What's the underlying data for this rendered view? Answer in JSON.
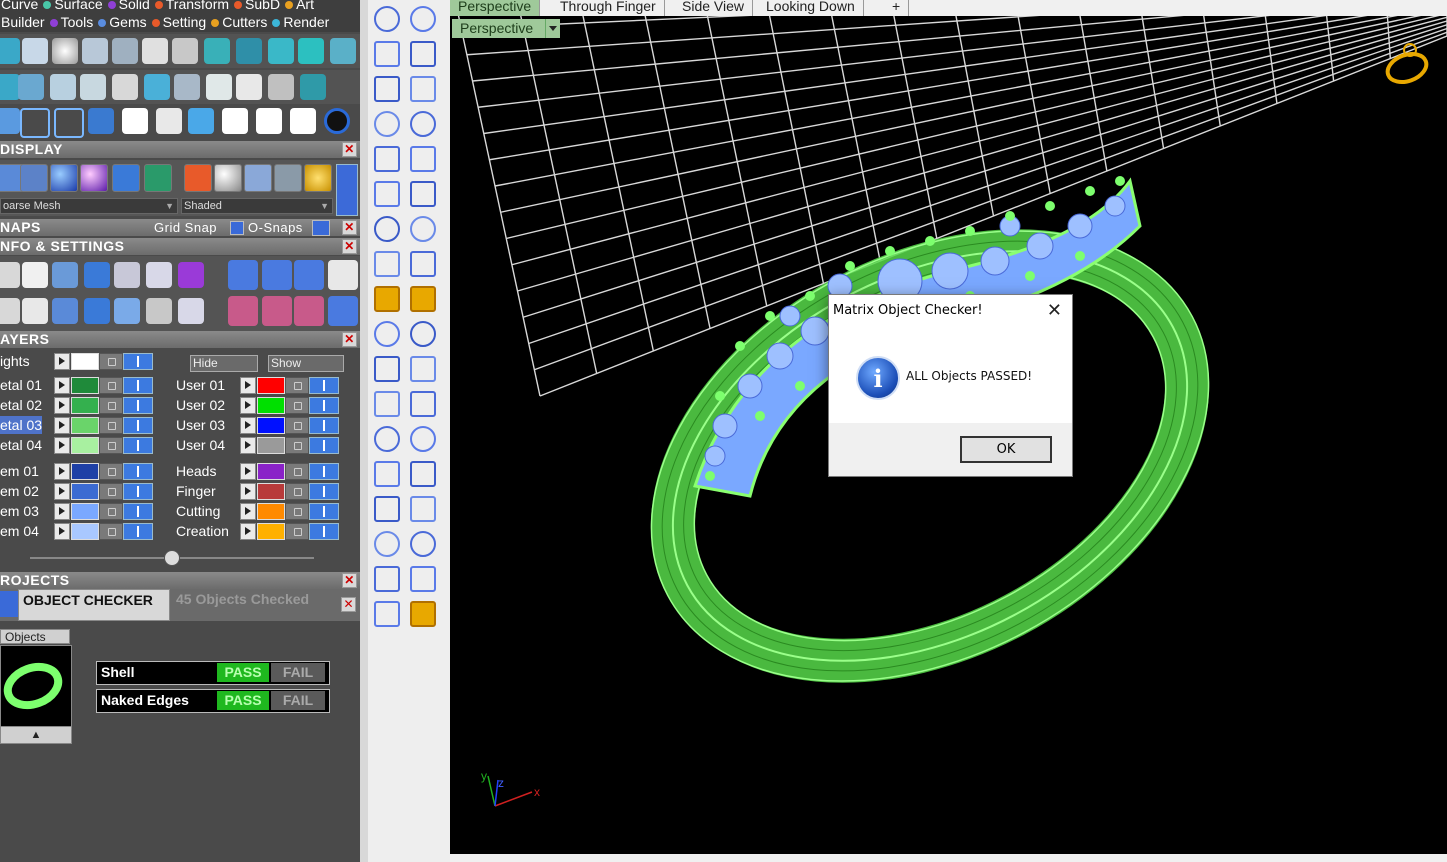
{
  "menus": {
    "row1": [
      "Curve",
      "Surface",
      "Solid",
      "Transform",
      "SubD",
      "Art"
    ],
    "row2": [
      "Builder",
      "Tools",
      "Gems",
      "Setting",
      "Cutters",
      "Render"
    ],
    "colors": [
      "#49c8a8",
      "#8f3fd6",
      "#5a8de0",
      "#e85a2a",
      "#e8a020",
      "#3cb6d8"
    ]
  },
  "sections": {
    "display": "DISPLAY",
    "snaps": "NAPS",
    "info_settings": "NFO & SETTINGS",
    "layers": "AYERS",
    "projects": "ROJECTS"
  },
  "display": {
    "mesh_combo": "oarse Mesh",
    "shade_combo": "Shaded"
  },
  "snaps": {
    "grid_snap": "Grid Snap",
    "osnaps": "O-Snaps"
  },
  "layers": {
    "hide_label": "Hide",
    "show_label": "Show",
    "left": [
      {
        "name": "ights",
        "color": "#ffffff"
      },
      {
        "name": "etal 01",
        "color": "#1f8a3a"
      },
      {
        "name": "etal 02",
        "color": "#34b04e"
      },
      {
        "name": "etal 03",
        "color": "#6ad46a"
      },
      {
        "name": "etal 04",
        "color": "#a8f0a0"
      },
      {
        "name": "em 01",
        "color": "#1e40a6"
      },
      {
        "name": "em 02",
        "color": "#3c6bd2"
      },
      {
        "name": "em 03",
        "color": "#7aa8ff"
      },
      {
        "name": "em 04",
        "color": "#a9c8ff"
      }
    ],
    "right": [
      {
        "name": "User 01",
        "color": "#ff0000"
      },
      {
        "name": "User 02",
        "color": "#00e000"
      },
      {
        "name": "User 03",
        "color": "#0010ff"
      },
      {
        "name": "User 04",
        "color": "#9a9a9a"
      },
      {
        "name": "Heads",
        "color": "#8a22c8"
      },
      {
        "name": "Finger",
        "color": "#b83a3a"
      },
      {
        "name": "Cutting",
        "color": "#ff8a00"
      },
      {
        "name": "Creation",
        "color": "#ffb000"
      }
    ]
  },
  "projects": {
    "title": "OBJECT CHECKER",
    "status": "45  Objects Checked",
    "objects_tab": "Objects",
    "checks": [
      {
        "label": "Shell",
        "pass": "PASS",
        "fail": "FAIL"
      },
      {
        "label": "Naked Edges",
        "pass": "PASS",
        "fail": "FAIL"
      }
    ]
  },
  "tabs": [
    "Perspective",
    "Through Finger",
    "Side View",
    "Looking Down"
  ],
  "viewport": {
    "label": "Perspective",
    "axis_x": "x",
    "axis_y": "y",
    "axis_z": "z"
  },
  "dialog": {
    "title": "Matrix Object Checker!",
    "message": "ALL Objects PASSED!",
    "ok": "OK"
  }
}
